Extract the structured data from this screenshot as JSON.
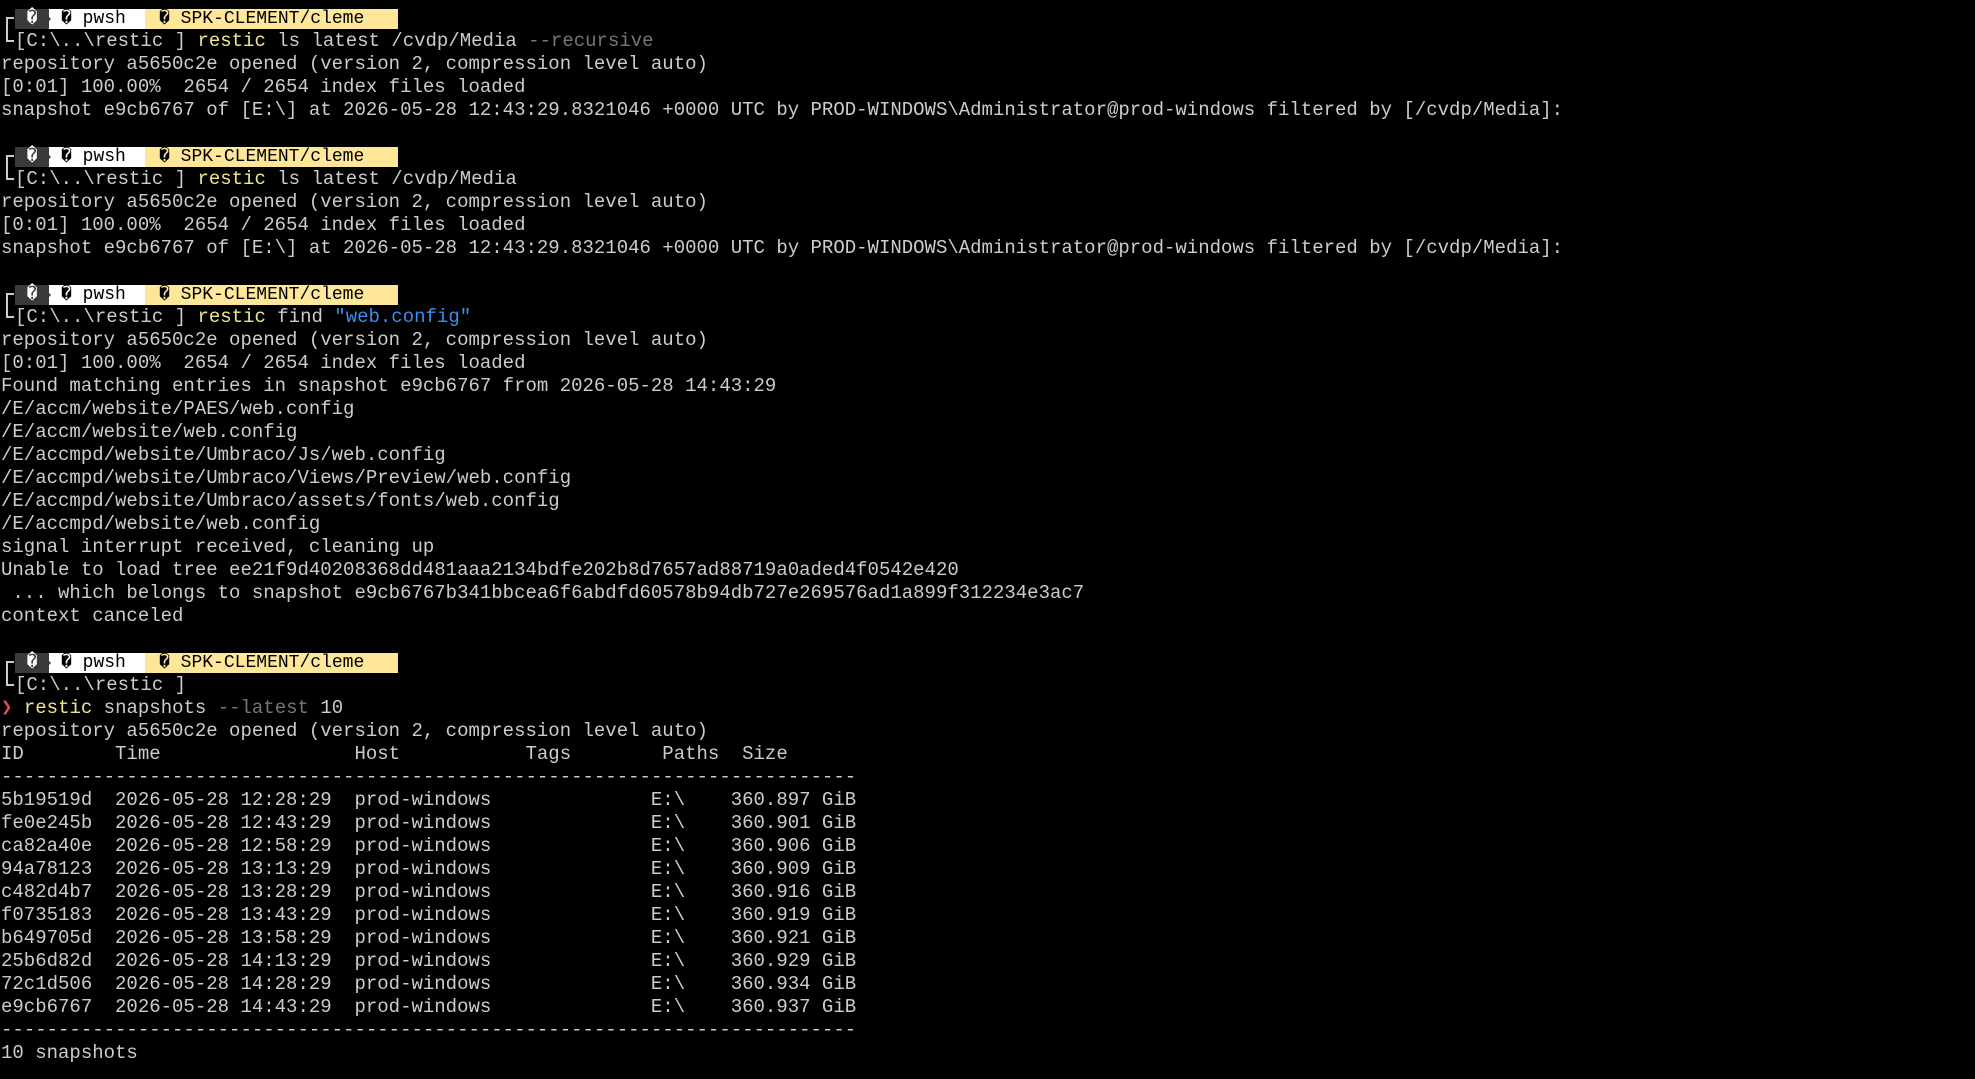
{
  "prompt": {
    "os_glyph": "�",
    "shell_glyph": "�",
    "shell": "pwsh",
    "user_glyph": "�",
    "user": "SPK-CLEMENT/cleme",
    "path": "C:\\..\\restic",
    "chevron": "❯",
    "colors": {
      "os_bg": "#3a3a3a",
      "shell_bg": "#ffffff",
      "user_bg": "#ffe79a",
      "exe": "#f0e68c",
      "flag": "#767676",
      "string": "#3b8eea",
      "chevron": "#e74856"
    }
  },
  "blocks": [
    {
      "command": {
        "exe": "restic",
        "args": " ls latest /cvdp/Media ",
        "flag": "--recursive",
        "string": "",
        "num": ""
      },
      "output": [
        "repository a5650c2e opened (version 2, compression level auto)",
        "[0:01] 100.00%  2654 / 2654 index files loaded",
        "snapshot e9cb6767 of [E:\\] at 2026-05-28 12:43:29.8321046 +0000 UTC by PROD-WINDOWS\\Administrator@prod-windows filtered by [/cvdp/Media]:"
      ]
    },
    {
      "command": {
        "exe": "restic",
        "args": " ls latest /cvdp/Media",
        "flag": "",
        "string": "",
        "num": ""
      },
      "output": [
        "repository a5650c2e opened (version 2, compression level auto)",
        "[0:01] 100.00%  2654 / 2654 index files loaded",
        "snapshot e9cb6767 of [E:\\] at 2026-05-28 12:43:29.8321046 +0000 UTC by PROD-WINDOWS\\Administrator@prod-windows filtered by [/cvdp/Media]:"
      ]
    },
    {
      "command": {
        "exe": "restic",
        "args": " find ",
        "flag": "",
        "string": "\"web.config\"",
        "num": ""
      },
      "output": [
        "repository a5650c2e opened (version 2, compression level auto)",
        "[0:01] 100.00%  2654 / 2654 index files loaded",
        "Found matching entries in snapshot e9cb6767 from 2026-05-28 14:43:29",
        "/E/accm/website/PAES/web.config",
        "/E/accm/website/web.config",
        "/E/accmpd/website/Umbraco/Js/web.config",
        "/E/accmpd/website/Umbraco/Views/Preview/web.config",
        "/E/accmpd/website/Umbraco/assets/fonts/web.config",
        "/E/accmpd/website/web.config",
        "signal interrupt received, cleaning up",
        "Unable to load tree ee21f9d40208368dd481aaa2134bdfe202b8d7657ad88719a0aded4f0542e420",
        " ... which belongs to snapshot e9cb6767b341bbcea6f6abdfd60578b94db727e269576ad1a899f312234e3ac7",
        "context canceled"
      ]
    }
  ],
  "last_block": {
    "command": {
      "exe": "restic",
      "args": " snapshots ",
      "flag": "--latest",
      "num": " 10"
    },
    "output_pre": [
      "repository a5650c2e opened (version 2, compression level auto)"
    ],
    "table": {
      "header": "ID        Time                 Host           Tags        Paths  Size",
      "rule": "---------------------------------------------------------------------------",
      "rows": [
        "5b19519d  2026-05-28 12:28:29  prod-windows              E:\\    360.897 GiB",
        "fe0e245b  2026-05-28 12:43:29  prod-windows              E:\\    360.901 GiB",
        "ca82a40e  2026-05-28 12:58:29  prod-windows              E:\\    360.906 GiB",
        "94a78123  2026-05-28 13:13:29  prod-windows              E:\\    360.909 GiB",
        "c482d4b7  2026-05-28 13:28:29  prod-windows              E:\\    360.916 GiB",
        "f0735183  2026-05-28 13:43:29  prod-windows              E:\\    360.919 GiB",
        "b649705d  2026-05-28 13:58:29  prod-windows              E:\\    360.921 GiB",
        "25b6d82d  2026-05-28 14:13:29  prod-windows              E:\\    360.929 GiB",
        "72c1d506  2026-05-28 14:28:29  prod-windows              E:\\    360.934 GiB",
        "e9cb6767  2026-05-28 14:43:29  prod-windows              E:\\    360.937 GiB"
      ],
      "footer": "10 snapshots"
    }
  }
}
